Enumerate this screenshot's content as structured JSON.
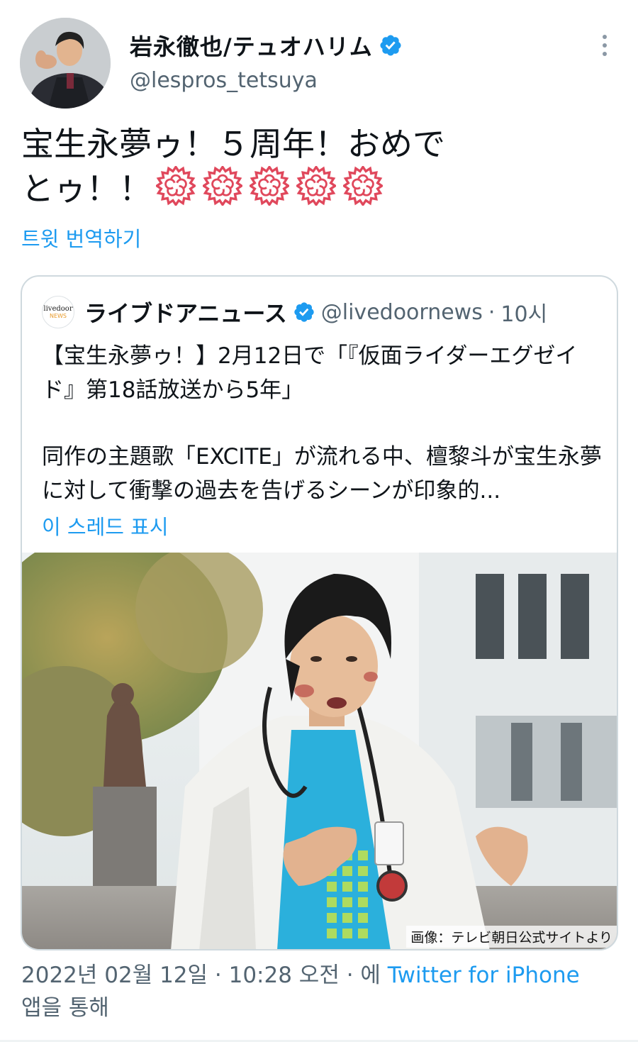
{
  "author": {
    "display_name": "岩永徹也/テュオハリム",
    "handle": "@lespros_tetsuya",
    "verified": true,
    "avatar_icon": "profile-photo"
  },
  "tweet": {
    "text_line1": "宝生永夢ゥ！５周年！おめで",
    "text_line2": "とゥ！！",
    "emoji_icon": "cherry-blossom-emoji",
    "emoji_count": 5,
    "translate_label": "트윗 번역하기"
  },
  "quoted": {
    "logo_line1": "livedoor",
    "logo_line2": "NEWS",
    "display_name": "ライブドアニュース",
    "handle": "@livedoornews",
    "separator": "·",
    "time": "10시",
    "headline": "【宝生永夢ゥ！】2月12日で「『仮面ライダーエグゼイド』第18話放送から5年」",
    "body": "同作の主題歌「EXCITE」が流れる中、檀黎斗が宝生永夢に対して衝撃の過去を告げるシーンが印象的...",
    "show_thread_label": "이 스레드 표시",
    "image_credit": "画像：テレビ朝日公式サイトより"
  },
  "meta": {
    "datetime": "2022년 02월 12일 · 10:28 오전 · 에",
    "source": "Twitter for iPhone",
    "suffix": "앱을 통해"
  },
  "colors": {
    "link": "#1d9bf0",
    "secondary_text": "#536471",
    "border": "#cfd9de",
    "flower": "#e0485c"
  }
}
